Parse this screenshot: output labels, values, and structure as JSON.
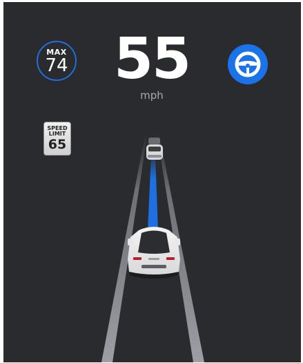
{
  "autopilot": {
    "max_label": "MAX",
    "max_speed": "74",
    "current_speed": "55",
    "speed_unit": "mph",
    "steering_icon": "steering-wheel-icon",
    "accent_color": "#1a73e8"
  },
  "speed_limit_sign": {
    "line1": "SPEED",
    "line2": "LIMIT",
    "value": "65"
  },
  "scene": {
    "lead_vehicle_icon": "car-icon",
    "ego_vehicle_icon": "car-icon",
    "path_color": "#1e6fe0"
  }
}
